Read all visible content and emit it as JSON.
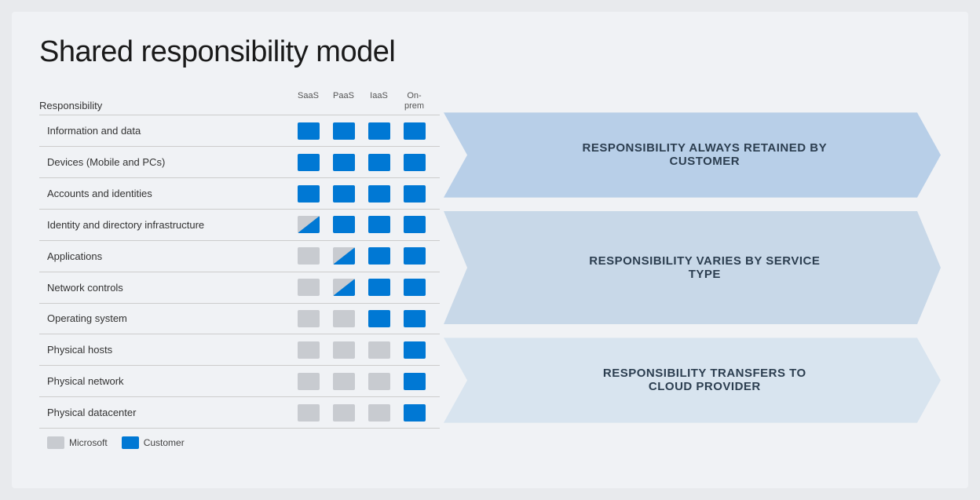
{
  "title": "Shared responsibility model",
  "header": {
    "responsibility_label": "Responsibility",
    "columns": [
      "SaaS",
      "PaaS",
      "IaaS",
      "On-\nprem"
    ]
  },
  "rows": [
    {
      "label": "Information and data",
      "cells": [
        "blue",
        "blue",
        "blue",
        "blue"
      ]
    },
    {
      "label": "Devices (Mobile and PCs)",
      "cells": [
        "blue",
        "blue",
        "blue",
        "blue"
      ]
    },
    {
      "label": "Accounts and identities",
      "cells": [
        "blue",
        "blue",
        "blue",
        "blue"
      ]
    },
    {
      "label": "Identity and directory infrastructure",
      "cells": [
        "split",
        "blue",
        "blue",
        "blue"
      ]
    },
    {
      "label": "Applications",
      "cells": [
        "gray",
        "split",
        "blue",
        "blue"
      ]
    },
    {
      "label": "Network controls",
      "cells": [
        "gray",
        "split",
        "blue",
        "blue"
      ]
    },
    {
      "label": "Operating system",
      "cells": [
        "gray",
        "gray",
        "blue",
        "blue"
      ]
    },
    {
      "label": "Physical hosts",
      "cells": [
        "gray",
        "gray",
        "gray",
        "blue"
      ]
    },
    {
      "label": "Physical network",
      "cells": [
        "gray",
        "gray",
        "gray",
        "blue"
      ]
    },
    {
      "label": "Physical datacenter",
      "cells": [
        "gray",
        "gray",
        "gray",
        "blue"
      ]
    }
  ],
  "arrows": [
    {
      "label": "RESPONSIBILITY ALWAYS RETAINED BY CUSTOMER",
      "rows": 3
    },
    {
      "label": "RESPONSIBILITY VARIES BY SERVICE TYPE",
      "rows": 4
    },
    {
      "label": "RESPONSIBILITY TRANSFERS TO CLOUD PROVIDER",
      "rows": 3
    }
  ],
  "legend": {
    "items": [
      {
        "type": "gray",
        "label": "Microsoft"
      },
      {
        "type": "blue",
        "label": "Customer"
      }
    ]
  }
}
